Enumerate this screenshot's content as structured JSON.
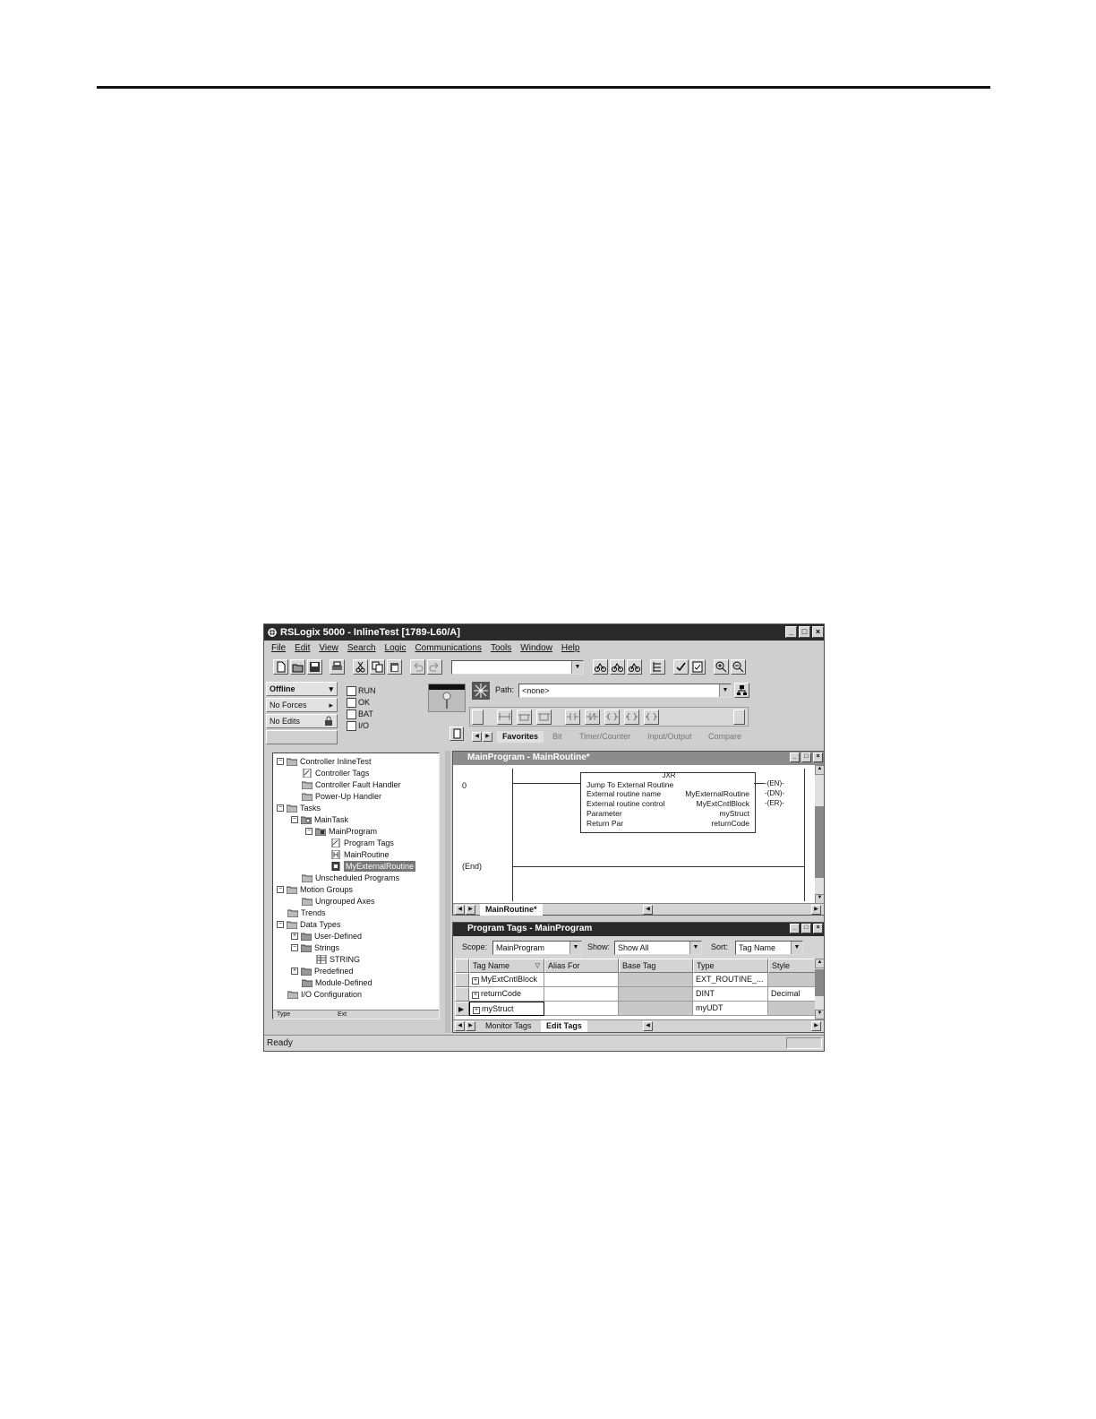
{
  "window": {
    "title": "RSLogix 5000 - InlineTest [1789-L60/A]",
    "buttons": [
      "_",
      "□",
      "×"
    ]
  },
  "menu": [
    "File",
    "Edit",
    "View",
    "Search",
    "Logic",
    "Communications",
    "Tools",
    "Window",
    "Help"
  ],
  "status": {
    "mode": "Offline",
    "forces": "No Forces",
    "edits": "No Edits",
    "checks": [
      "RUN",
      "OK",
      "BAT",
      "I/O"
    ]
  },
  "path": {
    "label": "Path:",
    "value": "<none>"
  },
  "instruction_tabs": [
    "Favorites",
    "Bit",
    "Timer/Counter",
    "Input/Output",
    "Compare"
  ],
  "tree": [
    "Controller InlineTest",
    "Controller Tags",
    "Controller Fault Handler",
    "Power-Up Handler",
    "Tasks",
    "MainTask",
    "MainProgram",
    "Program Tags",
    "MainRoutine",
    "MyExternalRoutine",
    "Unscheduled Programs",
    "Motion Groups",
    "Ungrouped Axes",
    "Trends",
    "Data Types",
    "User-Defined",
    "Strings",
    "STRING",
    "Predefined",
    "Module-Defined",
    "I/O Configuration"
  ],
  "tree_footer": [
    "Type",
    "Ext"
  ],
  "routine_window": {
    "title": "MainProgram - MainRoutine*",
    "rung0": "0",
    "end_label": "(End)",
    "block_name": "JXR",
    "rows": [
      {
        "label": "Jump To External Routine",
        "value": ""
      },
      {
        "label": "External routine name",
        "value": "MyExternalRoutine"
      },
      {
        "label": "External routine control",
        "value": "MyExtCntlBlock"
      },
      {
        "label": "Parameter",
        "value": "myStruct"
      },
      {
        "label": "Return Par",
        "value": "returnCode"
      }
    ],
    "outputs": [
      "EN",
      "DN",
      "ER"
    ],
    "tab": "MainRoutine*"
  },
  "tags_window": {
    "title": "Program Tags - MainProgram",
    "scope_label": "Scope:",
    "scope": "MainProgram",
    "show_label": "Show:",
    "show": "Show All",
    "sort_label": "Sort:",
    "sort": "Tag Name",
    "columns": [
      "Tag Name",
      "Alias For",
      "Base Tag",
      "Type",
      "Style"
    ],
    "rows": [
      {
        "name": "MyExtCntlBlock",
        "alias": "",
        "base": "",
        "type": "EXT_ROUTINE_...",
        "style": ""
      },
      {
        "name": "returnCode",
        "alias": "",
        "base": "",
        "type": "DINT",
        "style": "Decimal"
      },
      {
        "name": "myStruct",
        "alias": "",
        "base": "",
        "type": "myUDT",
        "style": ""
      }
    ],
    "tabs": [
      "Monitor Tags",
      "Edit Tags"
    ]
  },
  "statusbar": "Ready"
}
